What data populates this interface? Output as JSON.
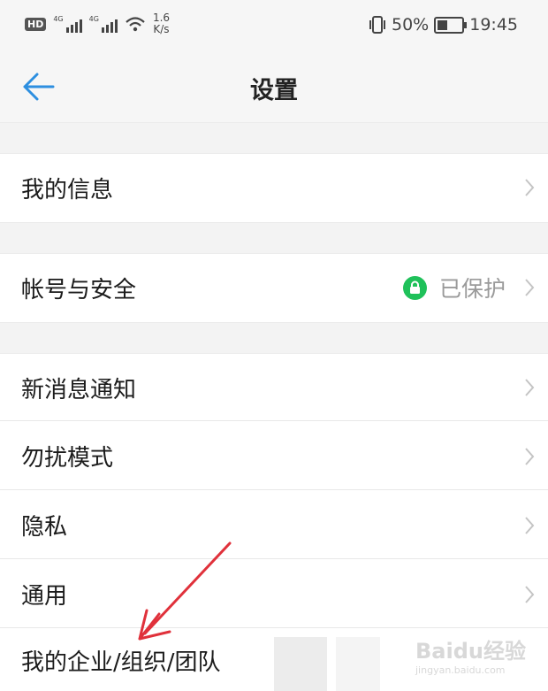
{
  "status_bar": {
    "hd_badge": "HD",
    "sim1_type": "4G",
    "sim2_type": "4G",
    "speed_value": "1.6",
    "speed_unit": "K/s",
    "battery_percent": "50%",
    "battery_level": 0.5,
    "time": "19:45"
  },
  "header": {
    "title": "设置",
    "back_icon": "back-arrow-icon"
  },
  "settings": {
    "my_info": "我的信息",
    "account_security": "帐号与安全",
    "account_status": "已保护",
    "new_message_notification": "新消息通知",
    "do_not_disturb": "勿扰模式",
    "privacy": "隐私",
    "general": "通用",
    "my_organization": "我的企业/组织/团队"
  },
  "overlay": {
    "watermark": "Baidu经验",
    "watermark_sub": "jingyan.baidu.com",
    "arrow_color": "#e0313b"
  },
  "colors": {
    "accent": "#2d8fe0",
    "protected_green": "#1fc15a"
  }
}
